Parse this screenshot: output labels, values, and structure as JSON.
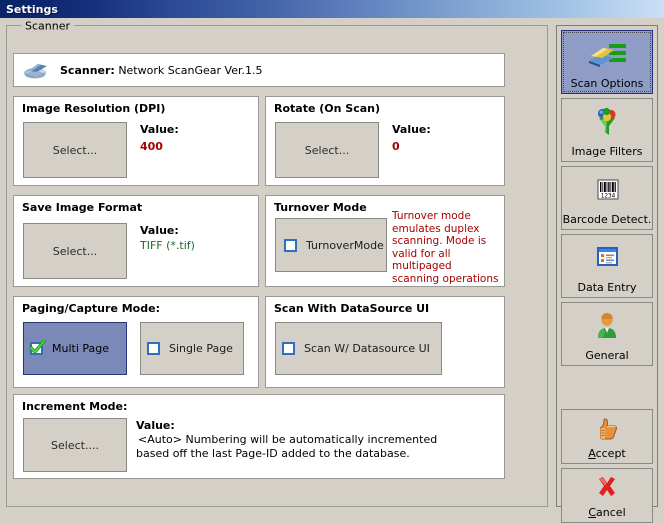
{
  "window": {
    "title": "Settings"
  },
  "group": {
    "legend": "Scanner"
  },
  "banner": {
    "icon": "scanner-icon",
    "label": "Scanner:",
    "value": "Network ScanGear Ver.1.5"
  },
  "sections": {
    "image_resolution": {
      "title": "Image Resolution (DPI)",
      "button": "Select...",
      "value_label": "Value:",
      "value": "400"
    },
    "rotate_on_scan": {
      "title": "Rotate (On Scan)",
      "button": "Select...",
      "value_label": "Value:",
      "value": "0"
    },
    "save_image_format": {
      "title": "Save Image Format",
      "button": "Select...",
      "value_label": "Value:",
      "value": "TIFF (*.tif)"
    },
    "turnover_mode": {
      "title": "Turnover Mode",
      "checkbox_label": "TurnoverMode",
      "checked": false,
      "note": "Turnover mode emulates duplex scanning.  Mode is valid for all multipaged scanning operations"
    },
    "paging_capture_mode": {
      "title": "Paging/Capture Mode:",
      "options": [
        {
          "label": "Multi Page",
          "checked": true
        },
        {
          "label": "Single Page",
          "checked": false
        }
      ]
    },
    "scan_with_datasource_ui": {
      "title": "Scan With DataSource UI",
      "checkbox_label": "Scan W/ Datasource UI",
      "checked": false
    },
    "increment_mode": {
      "title": "Increment Mode:",
      "button": "Select....",
      "value_label": "Value:",
      "value_line1": "<Auto>    Numbering will be automatically incremented",
      "value_line2": "based off the last Page-ID added to the database."
    }
  },
  "sidebar": {
    "buttons": [
      {
        "label": "Scan Options",
        "icon": "scan-options-icon",
        "active": true
      },
      {
        "label": "Image Filters",
        "icon": "funnel-icon",
        "active": false
      },
      {
        "label": "Barcode Detect.",
        "icon": "barcode-icon",
        "active": false
      },
      {
        "label": "Data Entry",
        "icon": "form-list-icon",
        "active": false
      },
      {
        "label": "General",
        "icon": "user-icon",
        "active": false
      }
    ],
    "actions": [
      {
        "label_prefix": "",
        "accel": "A",
        "label_rest": "ccept",
        "icon": "thumbs-up-icon"
      },
      {
        "label_prefix": "",
        "accel": "C",
        "label_rest": "ancel",
        "icon": "red-x-icon"
      }
    ]
  },
  "colors": {
    "window_bg": "#d4d0c8",
    "titlebar_start": "#0a246a",
    "card_bg": "#ffffff",
    "selected_blue": "#7b89b8",
    "value_red": "#a80000",
    "value_green": "#1d6b2a"
  }
}
